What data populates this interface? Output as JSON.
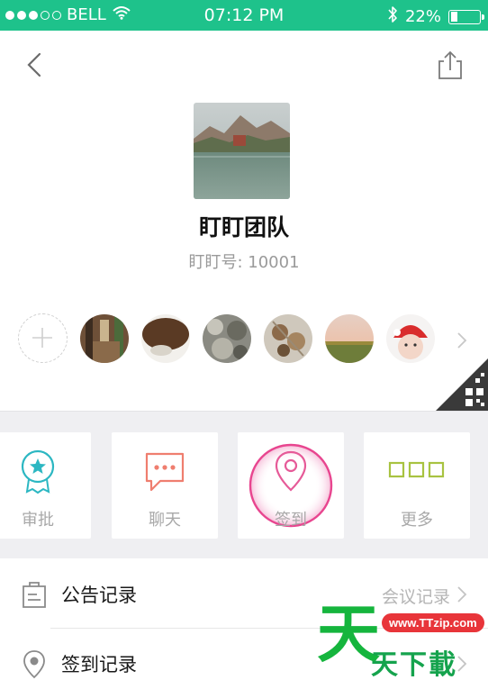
{
  "status_bar": {
    "carrier": "BELL",
    "time": "07:12 PM",
    "battery": "22%",
    "battery_level": 0.22,
    "signal_bars": 3,
    "signal_total": 5
  },
  "nav": {
    "back_icon": "chevron-left-icon",
    "share_icon": "share-icon"
  },
  "team": {
    "name": "盯盯团队",
    "id_text": "盯盯号: 10001"
  },
  "members": {
    "add_icon": "plus-icon",
    "next_icon": "chevron-right-icon",
    "avatars": [
      "market-street",
      "dark-knit",
      "gray-rocks",
      "dried-flowers",
      "field-sunset",
      "baby-red-hat"
    ]
  },
  "features": [
    {
      "label": "审批",
      "icon": "badge-icon",
      "color": "#2cb7c2"
    },
    {
      "label": "聊天",
      "icon": "chat-bubble-icon",
      "color": "#ef7e6f"
    },
    {
      "label": "签到",
      "icon": "location-pin-icon",
      "color": "#e65a98"
    },
    {
      "label": "更多",
      "icon": "more-squares-icon",
      "color": "#a8c341"
    }
  ],
  "records": {
    "announcements": "公告记录",
    "meetings": "会议记录",
    "checkins": "签到记录"
  },
  "watermark": {
    "url": "www.TTzip.com",
    "big": "天",
    "small": "天下載"
  }
}
